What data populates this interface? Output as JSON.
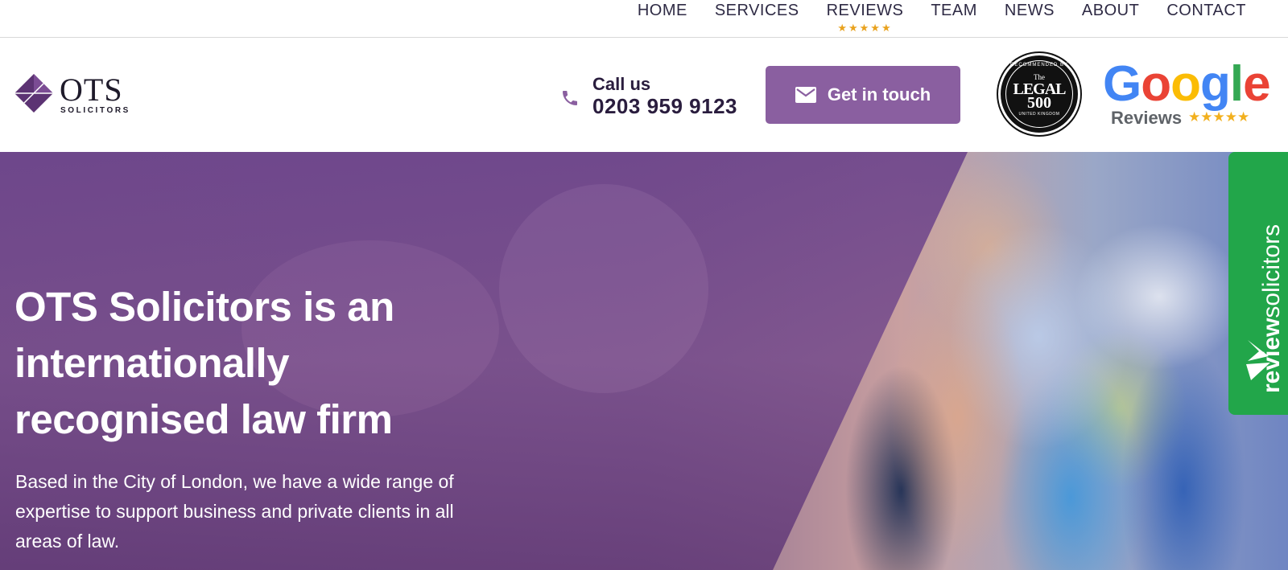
{
  "nav": {
    "items": [
      {
        "label": "HOME"
      },
      {
        "label": "SERVICES"
      },
      {
        "label": "REVIEWS",
        "stars": "★★★★★"
      },
      {
        "label": "TEAM"
      },
      {
        "label": "NEWS"
      },
      {
        "label": "ABOUT"
      },
      {
        "label": "CONTACT"
      }
    ]
  },
  "header": {
    "logo": {
      "wordmark": "OTS",
      "sub": "SOLICITORS"
    },
    "call": {
      "label": "Call us",
      "number": "0203 959 9123"
    },
    "cta": {
      "label": "Get in touch"
    },
    "legal500": {
      "arc": "RECOMMENDED BY",
      "the": "The",
      "line1": "LEGAL",
      "line2": "500",
      "country": "UNITED KINGDOM"
    },
    "google": {
      "word": "Google",
      "reviews": "Reviews",
      "stars": "★★★★★"
    }
  },
  "hero": {
    "title": "OTS Solicitors is an internationally recognised law firm",
    "body": "Based in the City of London, we have a wide range of expertise to support business and private clients in all areas of law."
  },
  "review_tab": {
    "bold": "review",
    "rest": "solicitors"
  },
  "colors": {
    "accent": "#8a5fa0",
    "star": "#e9a21e",
    "review_green": "#22a64a"
  }
}
